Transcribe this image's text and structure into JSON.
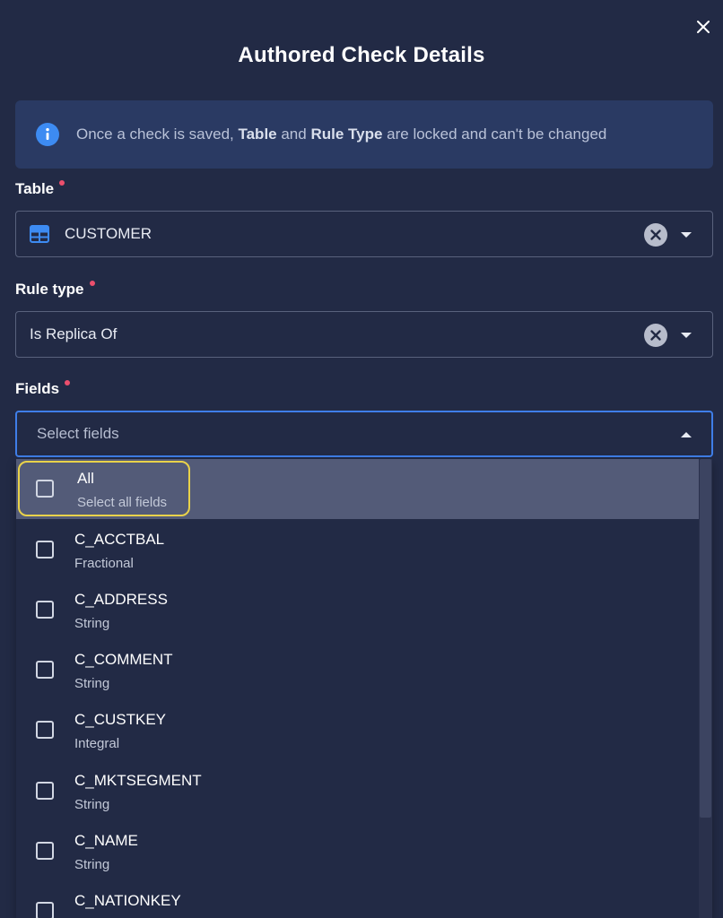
{
  "dialog": {
    "title": "Authored Check Details"
  },
  "banner": {
    "text_pre": "Once a check is saved, ",
    "table_word": "Table",
    "text_mid": " and ",
    "rule_word": "Rule Type",
    "text_post": " are locked and can't be changed"
  },
  "table_field": {
    "label": "Table",
    "value": "CUSTOMER"
  },
  "rule_field": {
    "label": "Rule type",
    "value": "Is Replica Of"
  },
  "fields_field": {
    "label": "Fields",
    "placeholder": "Select fields"
  },
  "options": [
    {
      "name": "All",
      "type": "Select all fields"
    },
    {
      "name": "C_ACCTBAL",
      "type": "Fractional"
    },
    {
      "name": "C_ADDRESS",
      "type": "String"
    },
    {
      "name": "C_COMMENT",
      "type": "String"
    },
    {
      "name": "C_CUSTKEY",
      "type": "Integral"
    },
    {
      "name": "C_MKTSEGMENT",
      "type": "String"
    },
    {
      "name": "C_NAME",
      "type": "String"
    },
    {
      "name": "C_NATIONKEY",
      "type": ""
    }
  ],
  "colors": {
    "background": "#222a45",
    "accent": "#3f7ee8",
    "required": "#ec4f6d",
    "highlight": "#e9d24a"
  }
}
